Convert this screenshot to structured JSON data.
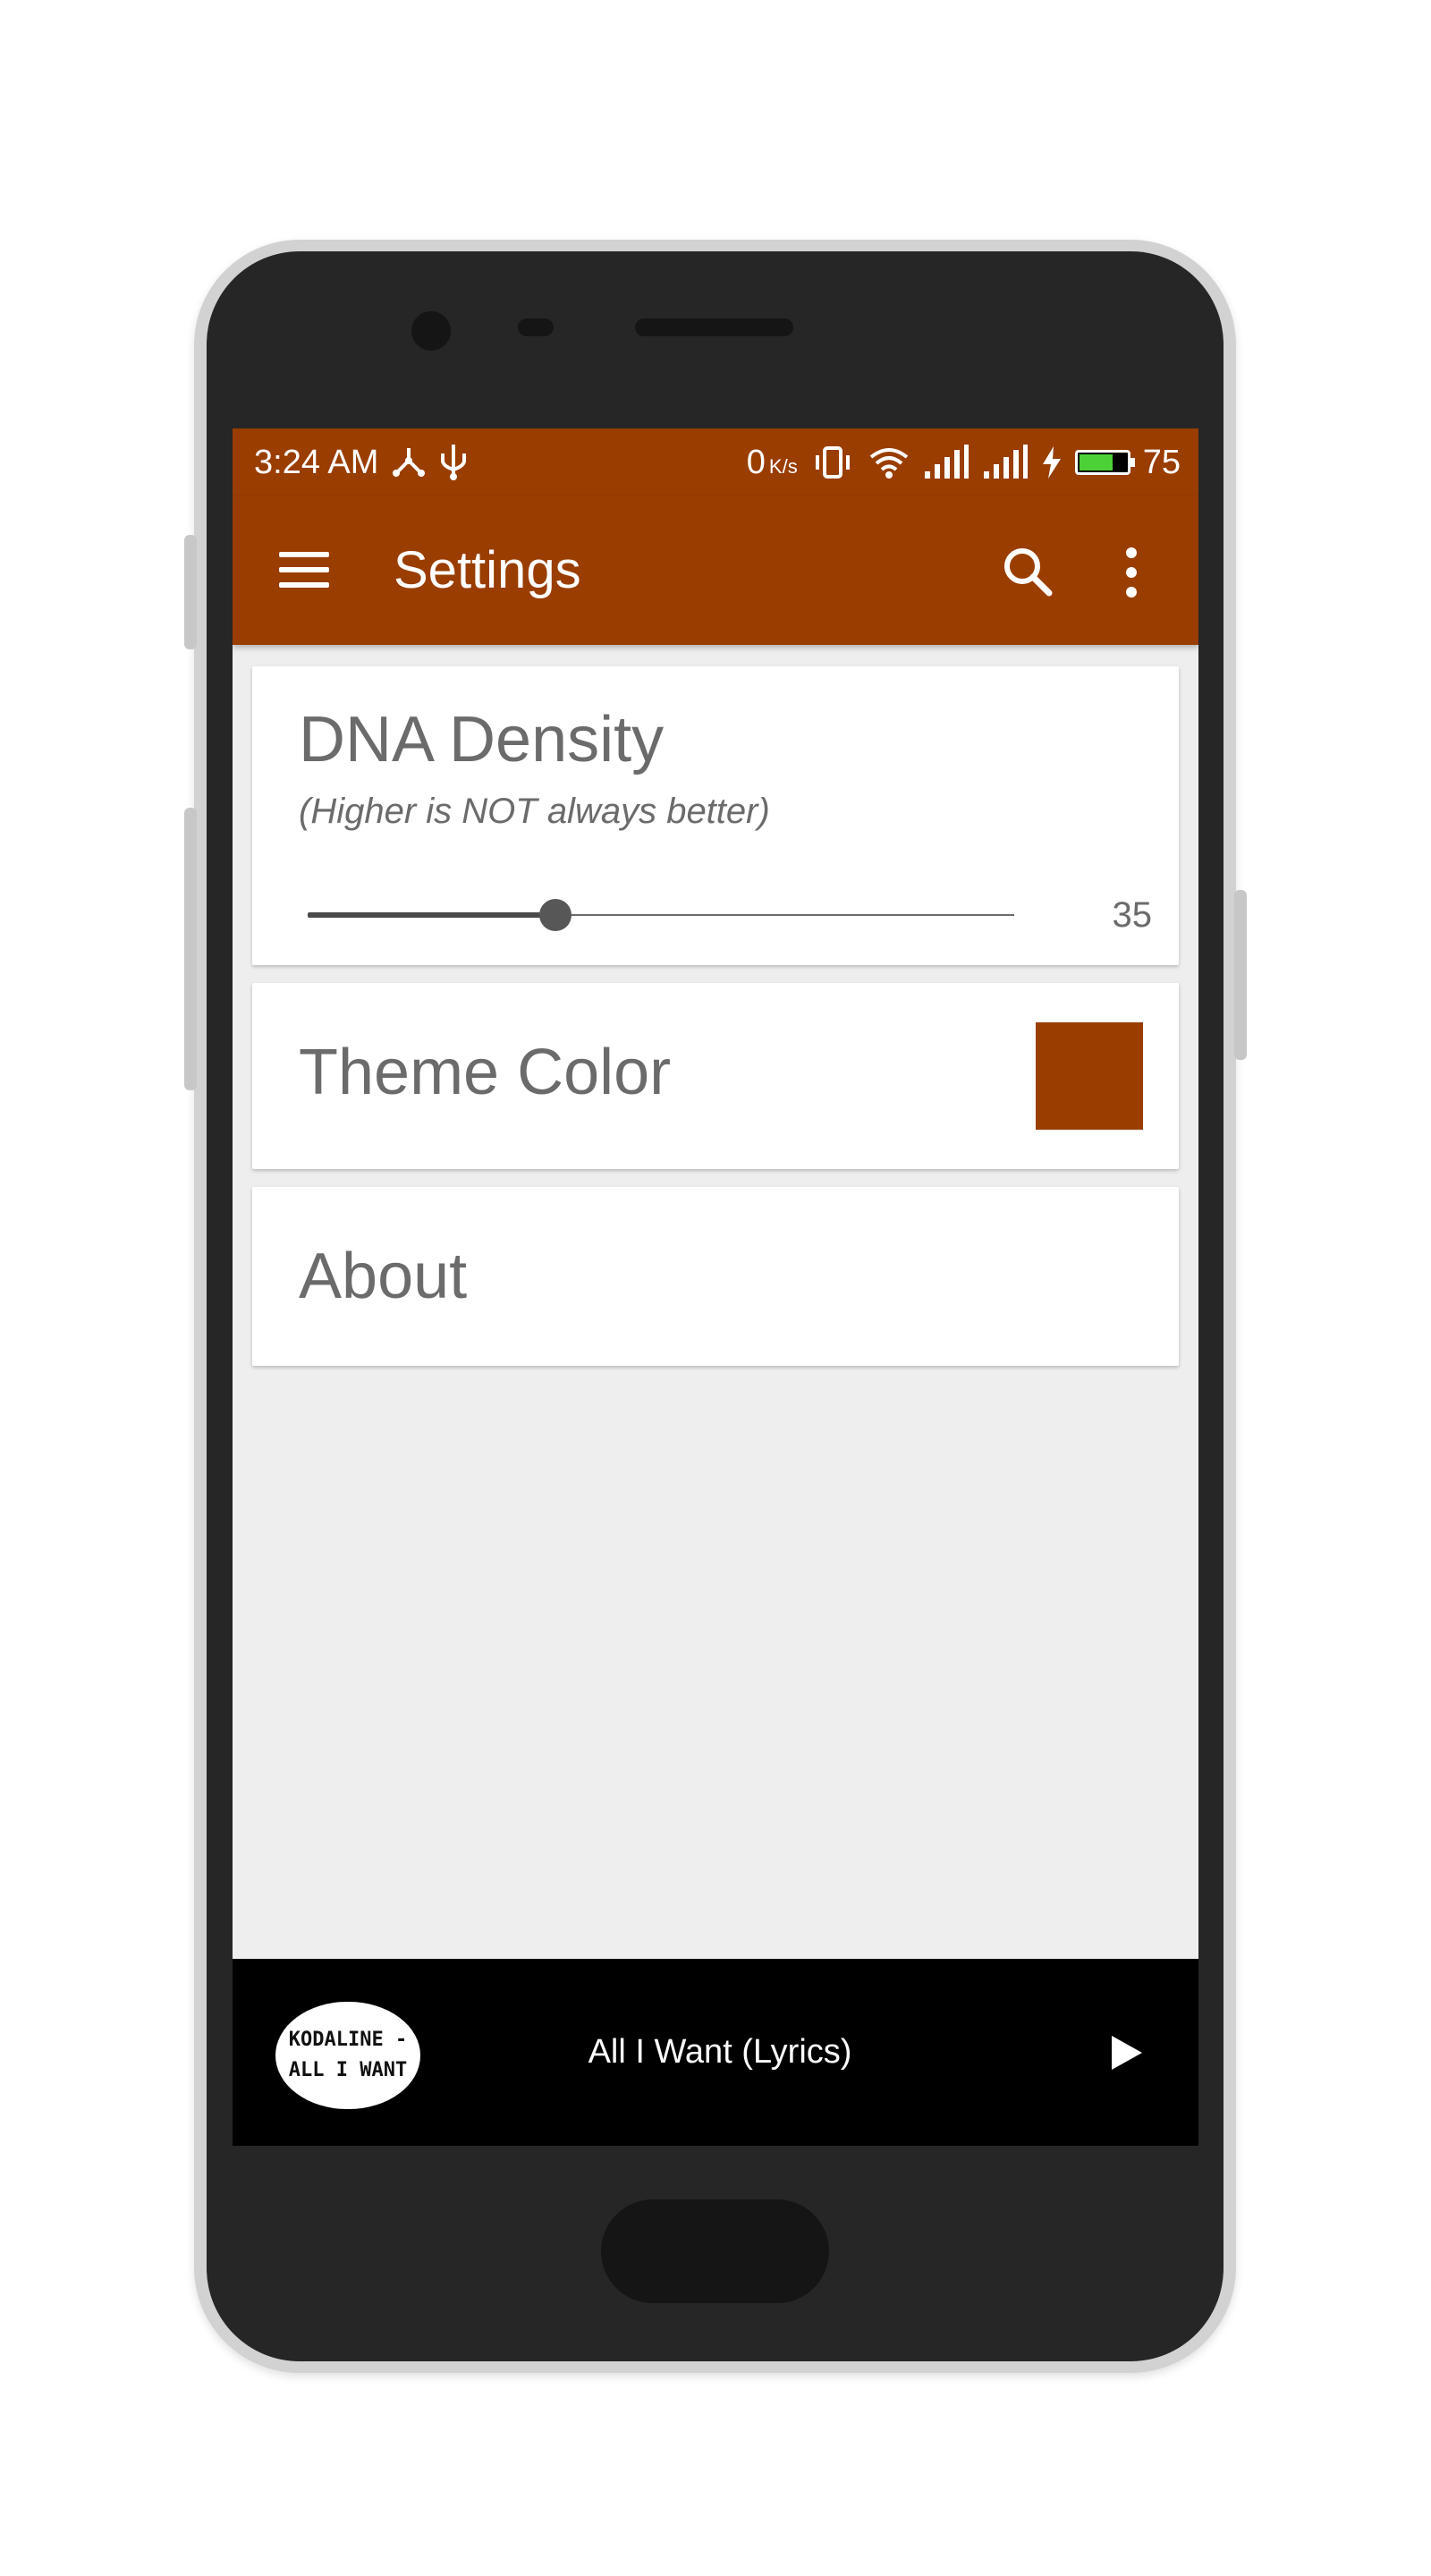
{
  "status_bar": {
    "time": "3:24 AM",
    "data_speed_value": "0",
    "data_speed_unit": "K/s",
    "battery_level": "75",
    "battery_fraction": 0.75,
    "icons": [
      "branch-icon",
      "usb-icon",
      "vibrate-icon",
      "wifi-icon",
      "signal-icon",
      "signal-icon",
      "charging-icon",
      "battery-icon"
    ]
  },
  "app_bar": {
    "title": "Settings",
    "icons": [
      "menu-icon",
      "search-icon",
      "more-vert-icon"
    ]
  },
  "settings": {
    "dna_density": {
      "title": "DNA Density",
      "subtitle": "(Higher is NOT always better)",
      "value": "35",
      "slider_fraction": 0.35
    },
    "theme_color": {
      "title": "Theme Color",
      "color": "#993d00"
    },
    "about": {
      "title": "About"
    }
  },
  "player": {
    "album_art_text": "KODALINE - ALL I WANT",
    "track_title": "All I Want (Lyrics)",
    "icons": [
      "play-icon"
    ]
  },
  "colors": {
    "primary": "#993d00",
    "background": "#eeeeee",
    "card": "#ffffff",
    "text_secondary": "#6b6b6b",
    "player_bg": "#000000"
  }
}
